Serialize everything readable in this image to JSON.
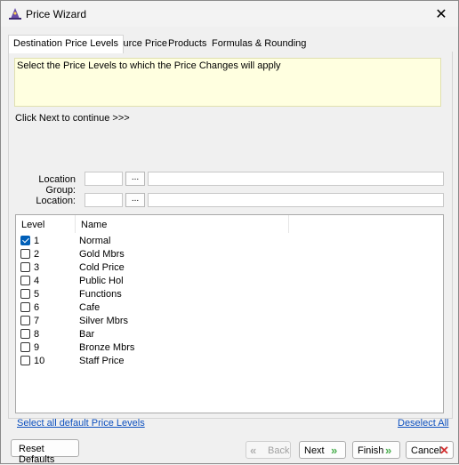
{
  "window": {
    "title": "Price Wizard"
  },
  "tabs": [
    {
      "label": "Destination Price Levels"
    },
    {
      "label": "Source Price"
    },
    {
      "label": "Products"
    },
    {
      "label": "Formulas & Rounding"
    }
  ],
  "note": {
    "text": "Select the Price Levels to which the Price Changes will apply"
  },
  "hint": {
    "text": "Click Next to continue >>>"
  },
  "location_group": {
    "label": "Location Group:",
    "code": "",
    "name": "",
    "button_label": "..."
  },
  "location": {
    "label": "Location:",
    "code": "",
    "name": "",
    "button_label": "..."
  },
  "table": {
    "columns": [
      "Level",
      "Name"
    ],
    "rows": [
      {
        "level": "1",
        "name": "Normal",
        "checked": true
      },
      {
        "level": "2",
        "name": "Gold Mbrs",
        "checked": false
      },
      {
        "level": "3",
        "name": "Cold Price",
        "checked": false
      },
      {
        "level": "4",
        "name": "Public Hol",
        "checked": false
      },
      {
        "level": "5",
        "name": "Functions",
        "checked": false
      },
      {
        "level": "6",
        "name": "Cafe",
        "checked": false
      },
      {
        "level": "7",
        "name": "Silver Mbrs",
        "checked": false
      },
      {
        "level": "8",
        "name": "Bar",
        "checked": false
      },
      {
        "level": "9",
        "name": "Bronze Mbrs",
        "checked": false
      },
      {
        "level": "10",
        "name": "Staff Price",
        "checked": false
      }
    ]
  },
  "links": {
    "select_all": "Select all default Price Levels",
    "deselect_all": "Deselect All"
  },
  "buttons": {
    "reset": "Reset Defaults",
    "back": "Back",
    "next": "Next",
    "finish": "Finish",
    "cancel": "Cancel"
  },
  "icons": {
    "app": "wizard-hat-icon",
    "close": "close-icon",
    "back": "double-chevron-left-icon",
    "next": "double-chevron-right-icon",
    "finish": "double-chevron-right-icon",
    "cancel": "red-x-icon"
  },
  "colors": {
    "note_bg": "#ffffe0",
    "link": "#0b4fbf",
    "check": "#005fb8",
    "arrow": "#4caf50",
    "cancel_x": "#d32f2f"
  }
}
